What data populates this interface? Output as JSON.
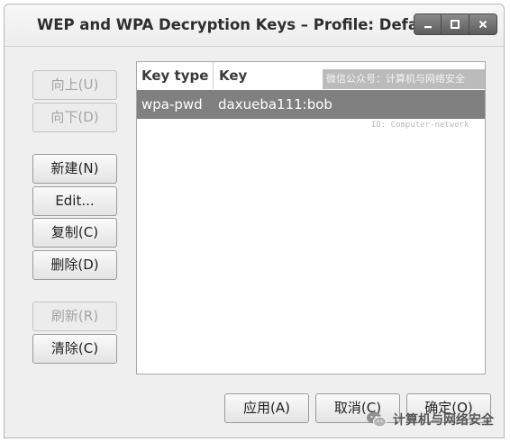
{
  "window": {
    "title": "WEP and WPA Decryption Keys – Profile: Default",
    "controls": {
      "minimize": "_",
      "maximize": "□",
      "close": "✕"
    }
  },
  "side_buttons": [
    {
      "label": "向上(U)",
      "enabled": false
    },
    {
      "label": "向下(D)",
      "enabled": false
    },
    {
      "label": "新建(N)",
      "enabled": true
    },
    {
      "label": "Edit...",
      "enabled": true
    },
    {
      "label": "复制(C)",
      "enabled": true
    },
    {
      "label": "删除(D)",
      "enabled": true
    },
    {
      "label": "刷新(R)",
      "enabled": false
    },
    {
      "label": "清除(C)",
      "enabled": true
    }
  ],
  "table": {
    "columns": [
      "Key type",
      "Key"
    ],
    "rows": [
      {
        "key_type": "wpa-pwd",
        "key": "daxueba111:bob",
        "selected": true
      }
    ]
  },
  "watermark": {
    "line1": "微信公众号：计算机与网络安全",
    "line2": "ID: Computer-network",
    "brand": "计算机与网络安全",
    "brand_icon": "wechat-icon"
  },
  "footer_buttons": {
    "apply": "应用(A)",
    "cancel": "取消(C)",
    "ok": "确定(O)"
  }
}
